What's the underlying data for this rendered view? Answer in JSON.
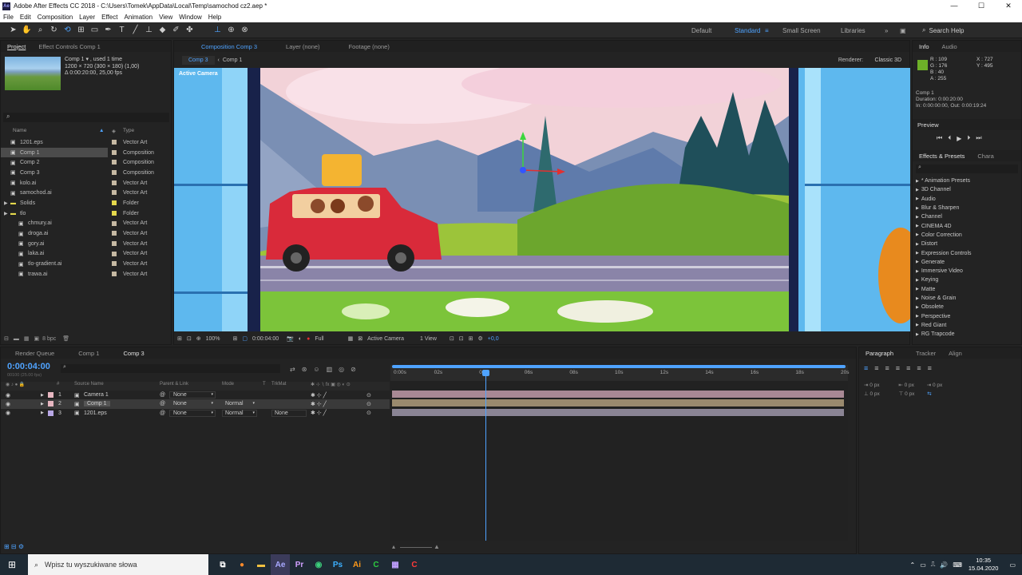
{
  "window": {
    "title": "Adobe After Effects CC 2018 - C:\\Users\\Tomek\\AppData\\Local\\Temp\\samochod cz2.aep *",
    "logo": "Ae",
    "minimize": "—",
    "maximize": "☐",
    "close": "✕"
  },
  "menu": [
    "File",
    "Edit",
    "Composition",
    "Layer",
    "Effect",
    "Animation",
    "View",
    "Window",
    "Help"
  ],
  "workspaces": {
    "default": "Default",
    "standard": "Standard",
    "small": "Small Screen",
    "libraries": "Libraries",
    "search_help": "Search Help"
  },
  "project": {
    "tabs": [
      "Project",
      "Effect Controls Comp 1"
    ],
    "thumb_title": "Comp 1 ▾ , used 1 time",
    "thumb_info1": "1200 × 720  (300 × 180) (1,00)",
    "thumb_info2": "Δ 0:00:20:00, 25,00 fps",
    "col_name": "Name",
    "col_type": "Type",
    "bpc": "8 bpc",
    "items": [
      {
        "name": "1201.eps",
        "type": "Vector Art",
        "color": "#c6b9a3"
      },
      {
        "name": "Comp 1",
        "type": "Composition",
        "color": "#c6b9a3"
      },
      {
        "name": "Comp 2",
        "type": "Composition",
        "color": "#c6b9a3"
      },
      {
        "name": "Comp 3",
        "type": "Composition",
        "color": "#c6b9a3"
      },
      {
        "name": "kolo.ai",
        "type": "Vector Art",
        "color": "#c6b9a3"
      },
      {
        "name": "samochod.ai",
        "type": "Vector Art",
        "color": "#c6b9a3"
      },
      {
        "name": "Solids",
        "type": "Folder",
        "color": "#e4d84c"
      },
      {
        "name": "tlo",
        "type": "Folder",
        "color": "#e4d84c"
      },
      {
        "name": "chmury.ai",
        "type": "Vector Art",
        "color": "#c6b9a3"
      },
      {
        "name": "droga.ai",
        "type": "Vector Art",
        "color": "#c6b9a3"
      },
      {
        "name": "gory.ai",
        "type": "Vector Art",
        "color": "#c6b9a3"
      },
      {
        "name": "laka.ai",
        "type": "Vector Art",
        "color": "#c6b9a3"
      },
      {
        "name": "tlo-gradient.ai",
        "type": "Vector Art",
        "color": "#c6b9a3"
      },
      {
        "name": "trawa.ai",
        "type": "Vector Art",
        "color": "#c6b9a3"
      }
    ]
  },
  "viewer": {
    "tabs": [
      "Composition Comp 3",
      "Layer (none)",
      "Footage (none)"
    ],
    "subtabs": [
      "Comp 3",
      "Comp 1"
    ],
    "renderer_label": "Renderer:",
    "renderer": "Classic 3D",
    "active_camera_label": "Active Camera",
    "zoom": "100%",
    "time": "0:00:04:00",
    "resolution": "Full",
    "camera": "Active Camera",
    "views": "1 View",
    "exposure": "+0,0"
  },
  "info": {
    "tabs": [
      "Info",
      "Audio"
    ],
    "r": "R : 109",
    "g": "G : 176",
    "b": "B : 40",
    "a": "A : 255",
    "x": "X : 727",
    "y": "Y : 495",
    "swatch": "#6db028",
    "comp": "Comp 1",
    "duration": "Duration: 0:00:20:00",
    "inout": "In: 0:00:00:00, Out: 0:00:19:24"
  },
  "preview": {
    "label": "Preview"
  },
  "effects": {
    "tabs": [
      "Effects & Presets",
      "Chara"
    ],
    "items": [
      "* Animation Presets",
      "3D Channel",
      "Audio",
      "Blur & Sharpen",
      "Channel",
      "CINEMA 4D",
      "Color Correction",
      "Distort",
      "Expression Controls",
      "Generate",
      "Immersive Video",
      "Keying",
      "Matte",
      "Noise & Grain",
      "Obsolete",
      "Perspective",
      "Red Giant",
      "RG Trapcode"
    ]
  },
  "timeline": {
    "tabs": [
      "Render Queue",
      "Comp 1",
      "Comp 3"
    ],
    "timecode": "0:00:04:00",
    "fps": "00100 (25.00 fps)",
    "cols": {
      "num": "#",
      "source": "Source Name",
      "parent": "Parent & Link",
      "mode": "Mode",
      "t": "T",
      "trkmat": "TrkMat"
    },
    "ruler": [
      "0:00s",
      "02s",
      "04s",
      "06s",
      "08s",
      "10s",
      "12s",
      "14s",
      "16s",
      "18s",
      "20s"
    ],
    "current_time_fraction": 0.2,
    "layers": [
      {
        "num": "1",
        "name": "Camera 1",
        "parent": "None",
        "mode": "",
        "trkmat": "",
        "color": "#e6b6c0",
        "bar": "#a88894"
      },
      {
        "num": "2",
        "name": "Comp 1",
        "parent": "None",
        "mode": "Normal",
        "trkmat": "",
        "color": "#e6b6c0",
        "bar": "#9a8a6e"
      },
      {
        "num": "3",
        "name": "1201.eps",
        "parent": "None",
        "mode": "Normal",
        "trkmat": "None",
        "color": "#b9a8e6",
        "bar": "#8a8494"
      }
    ]
  },
  "paragraph": {
    "tabs": [
      "Paragraph",
      "Tracker",
      "Align"
    ],
    "px1": "0 px",
    "px2": "0 px",
    "px3": "0 px",
    "px4": "0 px",
    "px5": "0 px"
  },
  "taskbar": {
    "search": "Wpisz tu wyszukiwane słowa",
    "time": "10:35",
    "date": "15.04.2020"
  }
}
